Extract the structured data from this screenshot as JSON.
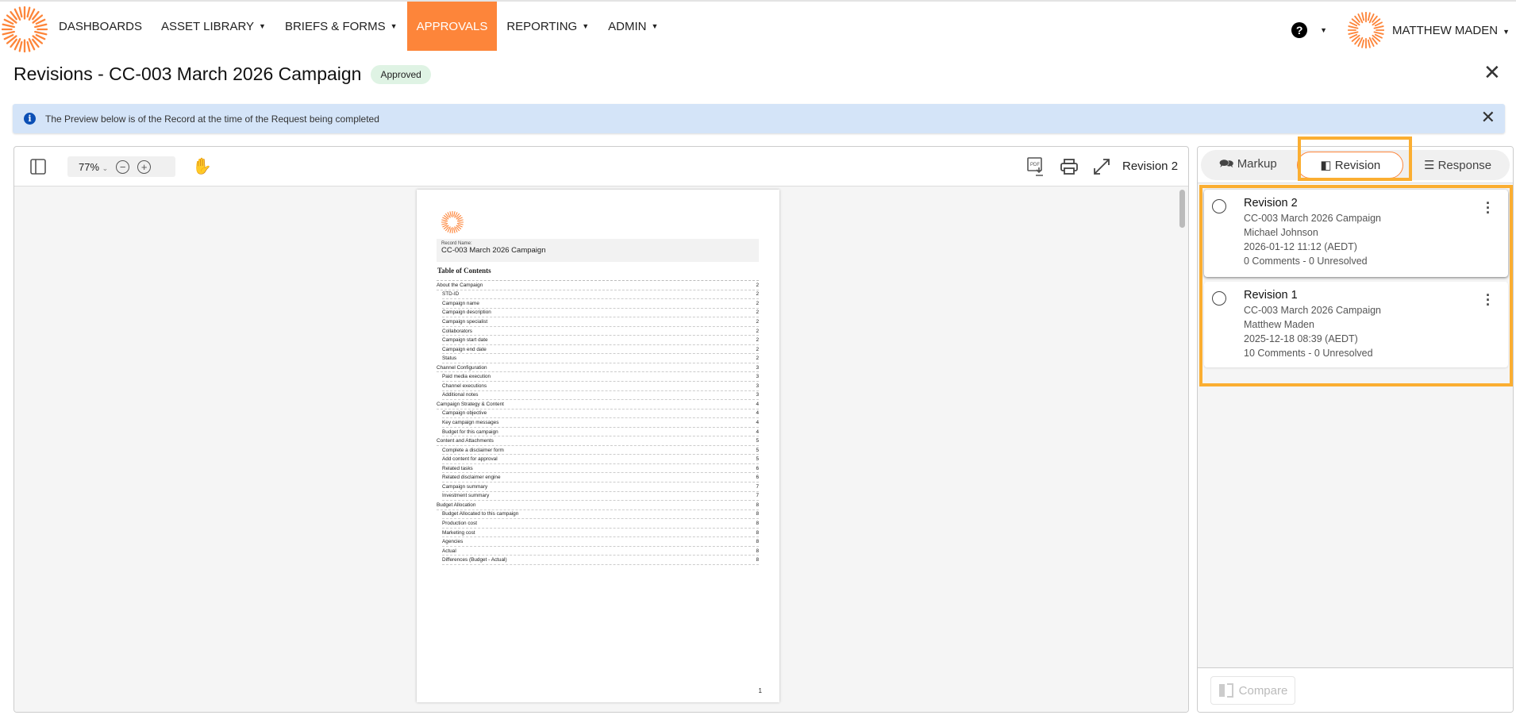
{
  "nav": {
    "items": [
      {
        "label": "DASHBOARDS",
        "caret": false
      },
      {
        "label": "ASSET LIBRARY",
        "caret": true
      },
      {
        "label": "BRIEFS & FORMS",
        "caret": true
      },
      {
        "label": "APPROVALS",
        "caret": false,
        "active": true
      },
      {
        "label": "REPORTING",
        "caret": true
      },
      {
        "label": "ADMIN",
        "caret": true
      }
    ],
    "help": "?",
    "user": "MATTHEW MADEN",
    "accent": "#fd853a"
  },
  "header": {
    "title": "Revisions - CC-003 March 2026 Campaign",
    "status": "Approved"
  },
  "banner": {
    "text": "The Preview below is of the Record at the time of the Request being completed"
  },
  "viewer": {
    "zoom": "77%",
    "revision_label": "Revision 2",
    "page": {
      "record_label": "Record Name:",
      "record_name": "CC-003 March 2026 Campaign",
      "toc_title": "Table of Contents",
      "page_number": "1",
      "toc": [
        {
          "t": "About the Campaign",
          "p": "2",
          "sub": false
        },
        {
          "t": "STD-ID",
          "p": "2",
          "sub": true
        },
        {
          "t": "Campaign name",
          "p": "2",
          "sub": true
        },
        {
          "t": "Campaign description",
          "p": "2",
          "sub": true
        },
        {
          "t": "Campaign specialist",
          "p": "2",
          "sub": true
        },
        {
          "t": "Collaborators",
          "p": "2",
          "sub": true
        },
        {
          "t": "Campaign start date",
          "p": "2",
          "sub": true
        },
        {
          "t": "Campaign end date",
          "p": "2",
          "sub": true
        },
        {
          "t": "Status",
          "p": "2",
          "sub": true
        },
        {
          "t": "Channel Configuration",
          "p": "3",
          "sub": false
        },
        {
          "t": "Paid media execution",
          "p": "3",
          "sub": true
        },
        {
          "t": "Channel executions",
          "p": "3",
          "sub": true
        },
        {
          "t": "Additional notes",
          "p": "3",
          "sub": true
        },
        {
          "t": "Campaign Strategy & Content",
          "p": "4",
          "sub": false
        },
        {
          "t": "Campaign objective",
          "p": "4",
          "sub": true
        },
        {
          "t": "Key campaign messages",
          "p": "4",
          "sub": true
        },
        {
          "t": "Budget for this campaign",
          "p": "4",
          "sub": true
        },
        {
          "t": "Content and Attachments",
          "p": "5",
          "sub": false
        },
        {
          "t": "Complete a disclaimer form",
          "p": "5",
          "sub": true
        },
        {
          "t": "Add content for approval",
          "p": "5",
          "sub": true
        },
        {
          "t": "Related tasks",
          "p": "6",
          "sub": true
        },
        {
          "t": "Related disclaimer engine",
          "p": "6",
          "sub": true
        },
        {
          "t": "Campaign summary",
          "p": "7",
          "sub": true
        },
        {
          "t": "Investment summary",
          "p": "7",
          "sub": true
        },
        {
          "t": "Budget Allocation",
          "p": "8",
          "sub": false
        },
        {
          "t": "Budget Allocated to this campaign",
          "p": "8",
          "sub": true
        },
        {
          "t": "Production cost",
          "p": "8",
          "sub": true
        },
        {
          "t": "Marketing cost",
          "p": "8",
          "sub": true
        },
        {
          "t": "Agencies",
          "p": "8",
          "sub": true
        },
        {
          "t": "Actual",
          "p": "8",
          "sub": true
        },
        {
          "t": "Differences (Budget - Actual)",
          "p": "8",
          "sub": true
        }
      ]
    }
  },
  "panel": {
    "tabs": [
      "Markup",
      "Revision",
      "Response"
    ],
    "active_tab": "Revision",
    "revisions": [
      {
        "name": "Revision 2",
        "record": "CC-003 March 2026 Campaign",
        "author": "Michael Johnson",
        "date": "2026-01-12 11:12 (AEDT)",
        "comments": "0 Comments - 0 Unresolved"
      },
      {
        "name": "Revision 1",
        "record": "CC-003 March 2026 Campaign",
        "author": "Matthew Maden",
        "date": "2025-12-18 08:39 (AEDT)",
        "comments": "10 Comments - 0 Unresolved"
      }
    ],
    "compare": "Compare"
  }
}
